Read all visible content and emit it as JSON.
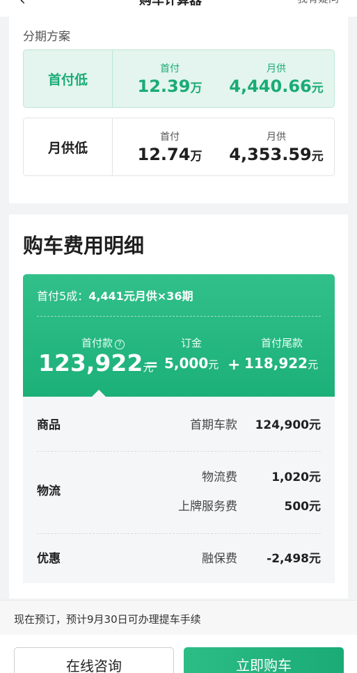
{
  "topbar": {
    "back": "‹",
    "title": "购车计算器",
    "right_label": "我有疑问"
  },
  "installment": {
    "section_label": "分期方案",
    "options": [
      {
        "name": "首付低",
        "down_label": "首付",
        "down_value": "12.39",
        "down_unit": "万",
        "monthly_label": "月供",
        "monthly_value": "4,440.66",
        "monthly_unit": "元",
        "selected": true
      },
      {
        "name": "月供低",
        "down_label": "首付",
        "down_value": "12.74",
        "down_unit": "万",
        "monthly_label": "月供",
        "monthly_value": "4,353.59",
        "monthly_unit": "元",
        "selected": false
      }
    ]
  },
  "cost": {
    "title": "购车费用明细",
    "plan_prefix": "首付5成：",
    "plan_detail": "4,441元月供×36期",
    "down": {
      "label": "首付款",
      "help_icon": "?",
      "value": "123,922",
      "unit": "元"
    },
    "eq": "=",
    "plus": "+",
    "deposit": {
      "label": "订金",
      "value": "5,000",
      "unit": "元"
    },
    "balance": {
      "label": "首付尾款",
      "value": "118,922",
      "unit": "元"
    },
    "rows": {
      "goods": {
        "category": "商品",
        "label": "首期车款",
        "value": "124,900元"
      },
      "logistics": {
        "category": "物流",
        "fee_label": "物流费",
        "fee_value": "1,020元",
        "plate_label": "上牌服务费",
        "plate_value": "500元"
      },
      "discount": {
        "category": "优惠",
        "label": "融保费",
        "value": "-2,498元"
      }
    }
  },
  "notice": "现在预订，预计9月30日可办理提车手续",
  "buttons": {
    "consult": "在线咨询",
    "buy": "立即购车"
  },
  "colors": {
    "accent": "#1aab76",
    "accent_light": "#e3f5ee"
  }
}
